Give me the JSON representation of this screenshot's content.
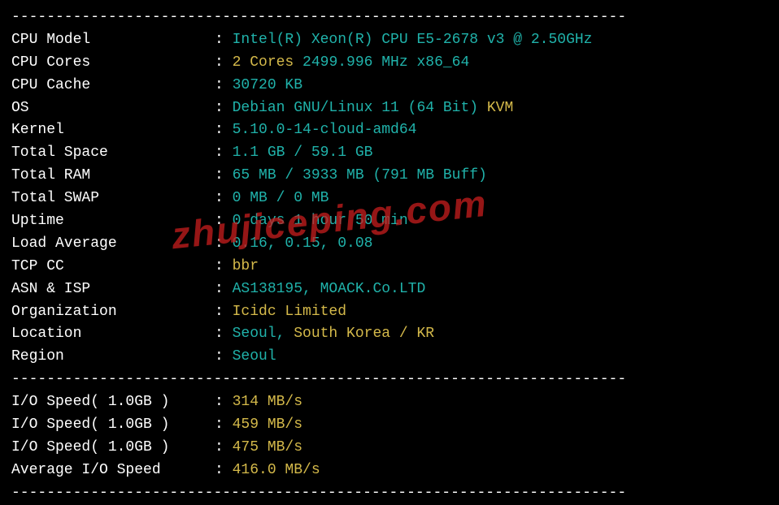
{
  "divider": "----------------------------------------------------------------------",
  "rows": [
    {
      "label": "CPU Model            ",
      "parts": [
        {
          "text": "Intel(R) Xeon(R) CPU E5-2678 v3 @ 2.50GHz",
          "cls": "val-teal"
        }
      ]
    },
    {
      "label": "CPU Cores            ",
      "parts": [
        {
          "text": "2 Cores",
          "cls": "val-yellow"
        },
        {
          "text": " 2499.996 MHz x86_64",
          "cls": "val-teal"
        }
      ]
    },
    {
      "label": "CPU Cache            ",
      "parts": [
        {
          "text": "30720 KB",
          "cls": "val-teal"
        }
      ]
    },
    {
      "label": "OS                   ",
      "parts": [
        {
          "text": "Debian GNU/Linux 11 (64 Bit)",
          "cls": "val-teal"
        },
        {
          "text": " KVM",
          "cls": "val-yellow"
        }
      ]
    },
    {
      "label": "Kernel               ",
      "parts": [
        {
          "text": "5.10.0-14-cloud-amd64",
          "cls": "val-teal"
        }
      ]
    },
    {
      "label": "Total Space          ",
      "parts": [
        {
          "text": "1.1 GB / 59.1 GB",
          "cls": "val-teal"
        }
      ]
    },
    {
      "label": "Total RAM            ",
      "parts": [
        {
          "text": "65 MB / 3933 MB (791 MB Buff)",
          "cls": "val-teal"
        }
      ]
    },
    {
      "label": "Total SWAP           ",
      "parts": [
        {
          "text": "0 MB / 0 MB",
          "cls": "val-teal"
        }
      ]
    },
    {
      "label": "Uptime               ",
      "parts": [
        {
          "text": "0 days 1 hour 50 min",
          "cls": "val-teal"
        }
      ]
    },
    {
      "label": "Load Average         ",
      "parts": [
        {
          "text": "0.16, 0.15, 0.08",
          "cls": "val-teal"
        }
      ]
    },
    {
      "label": "TCP CC               ",
      "parts": [
        {
          "text": "bbr",
          "cls": "val-yellow"
        }
      ]
    },
    {
      "label": "ASN & ISP            ",
      "parts": [
        {
          "text": "AS138195, MOACK.Co.LTD",
          "cls": "val-teal"
        }
      ]
    },
    {
      "label": "Organization         ",
      "parts": [
        {
          "text": "Icidc Limited",
          "cls": "val-yellow"
        }
      ]
    },
    {
      "label": "Location             ",
      "parts": [
        {
          "text": "Seoul,",
          "cls": "val-teal"
        },
        {
          "text": " South Korea / KR",
          "cls": "val-yellow"
        }
      ]
    },
    {
      "label": "Region               ",
      "parts": [
        {
          "text": "Seoul",
          "cls": "val-teal"
        }
      ]
    }
  ],
  "io_rows": [
    {
      "label": "I/O Speed( 1.0GB )   ",
      "value": "314 MB/s"
    },
    {
      "label": "I/O Speed( 1.0GB )   ",
      "value": "459 MB/s"
    },
    {
      "label": "I/O Speed( 1.0GB )   ",
      "value": "475 MB/s"
    },
    {
      "label": "Average I/O Speed    ",
      "value": "416.0 MB/s"
    }
  ],
  "colon": ": ",
  "watermark": "zhujiceping.com"
}
